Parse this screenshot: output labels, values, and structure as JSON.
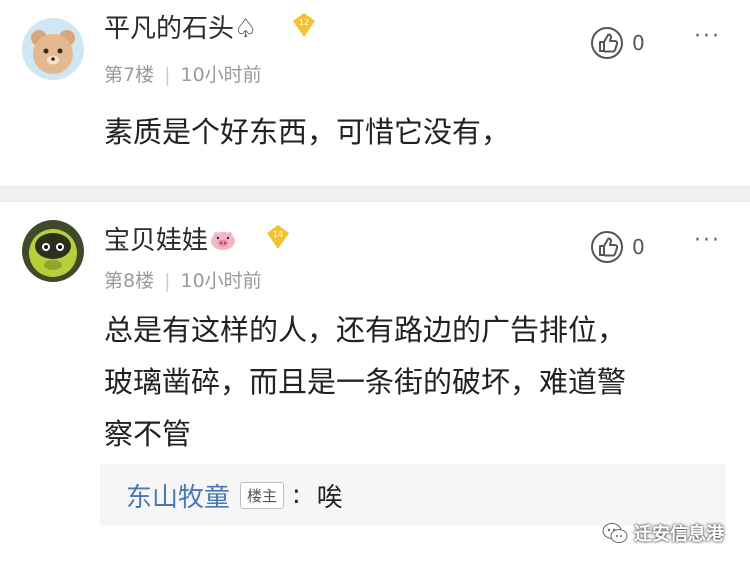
{
  "comments": [
    {
      "username": "平凡的石头",
      "username_suffix": "♤",
      "level": "12",
      "floor": "第7楼",
      "time": "10小时前",
      "likes": "0",
      "more": "···",
      "body": "素质是个好东西，可惜它没有，",
      "avatar_icon": "bear-avatar-icon"
    },
    {
      "username": "宝贝娃娃",
      "username_suffix": "🐷",
      "level": "14",
      "floor": "第8楼",
      "time": "10小时前",
      "likes": "0",
      "more": "···",
      "body_lines": [
        "总是有这样的人，还有路边的广告排位，",
        "玻璃凿碎，而且是一条街的破坏，难道警",
        "察不管"
      ],
      "avatar_icon": "green-character-avatar-icon",
      "reply": {
        "name": "东山牧童",
        "tag": "楼主",
        "separator": ":",
        "text": "唉"
      }
    }
  ],
  "watermark": {
    "text": "迁安信息港",
    "icon": "wechat-icon"
  },
  "colors": {
    "badge": "#f5c233",
    "reply_name": "#4a78b5",
    "meta": "#9a9a9a",
    "divider": "#f1f1f1"
  }
}
